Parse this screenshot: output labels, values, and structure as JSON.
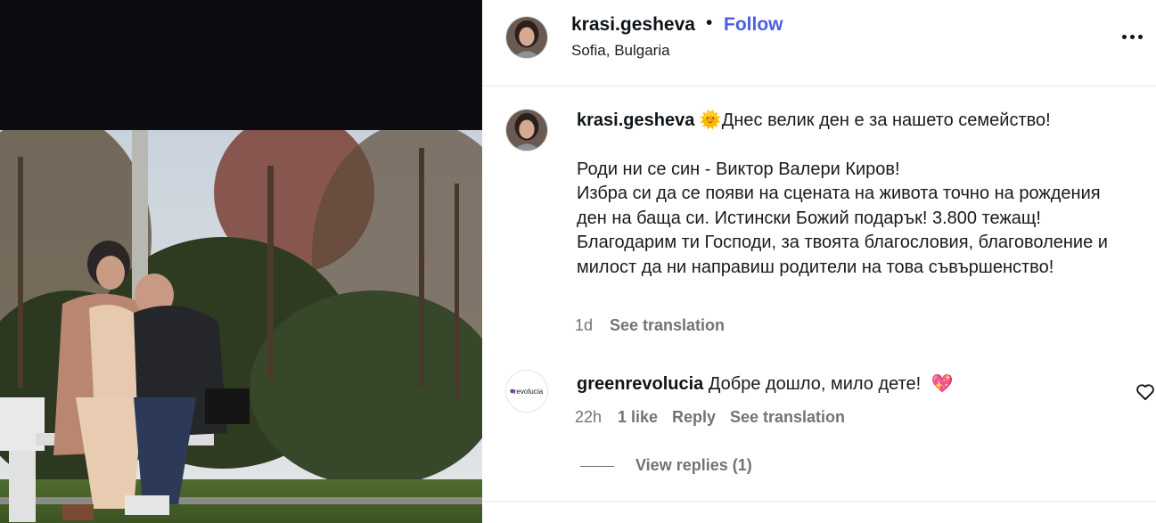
{
  "post": {
    "username": "krasi.gesheva",
    "separator": "•",
    "follow_label": "Follow",
    "location": "Sofia, Bulgaria",
    "more_icon": "more-horizontal-icon"
  },
  "caption": {
    "username": "krasi.gesheva",
    "emoji": "🌞",
    "line1": "Днес велик ден е за нашето семейство!",
    "body": "Роди ни се син - Виктор Валери Киров!\nИзбра си да се появи на сцената на живота точно на рождения ден на баща си. Истински Божий подарък! 3.800 тежащ!\nБлагодарим ти Господи, за твоята благословия, благоволение и милост да ни направиш родители на това съвършенство!",
    "time": "1d",
    "see_translation": "See translation"
  },
  "comment": {
    "username": "greenrevolucia",
    "avatar_text": "revolucia",
    "text": "Добре дошло, мило дете!",
    "emoji": "💖",
    "time": "22h",
    "likes": "1 like",
    "reply_label": "Reply",
    "see_translation": "See translation",
    "view_replies": "View replies (1)",
    "like_icon": "heart-outline-icon"
  },
  "colors": {
    "follow": "#4a5de6",
    "muted": "#737373",
    "media_bg": "#0b0d12"
  }
}
